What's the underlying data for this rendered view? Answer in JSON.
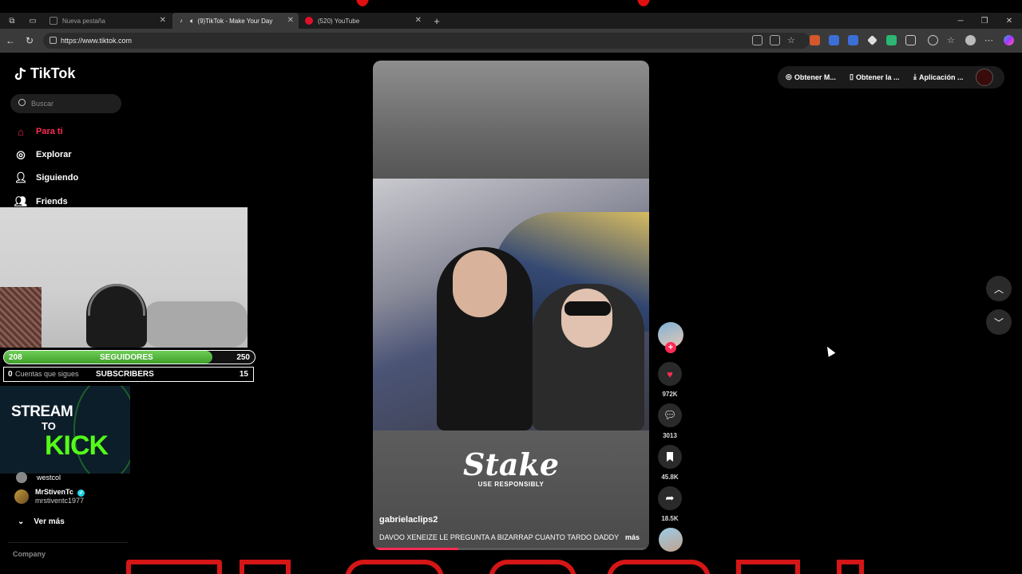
{
  "browser": {
    "tabs": [
      {
        "title": "Nueva pestaña",
        "active": false
      },
      {
        "title": "(9)TikTok - Make Your Day",
        "active": true
      },
      {
        "title": "(520) YouTube",
        "active": false
      }
    ],
    "url": "https://www.tiktok.com"
  },
  "sidebar": {
    "logo": "TikTok",
    "search_placeholder": "Buscar",
    "nav": [
      {
        "label": "Para ti"
      },
      {
        "label": "Explorar"
      },
      {
        "label": "Siguiendo"
      },
      {
        "label": "Friends"
      }
    ],
    "accounts": [
      {
        "name": "westcol",
        "handle": ""
      },
      {
        "name": "MrStivenTc",
        "handle": "mrstiventc1977"
      }
    ],
    "see_more": "Ver más",
    "footer_heading": "Company"
  },
  "overlay": {
    "followers": {
      "current": "208",
      "label": "SEGUIDORES",
      "goal": "250",
      "progress": 0.832
    },
    "subs": {
      "following_count": "0",
      "following_label": "Cuentas que sigues",
      "label": "SUBSCRIBERS",
      "count": "15"
    },
    "kick": {
      "line1": "STREAM",
      "line2": "TO",
      "line3": "KICK"
    }
  },
  "video": {
    "sponsor": "Stake",
    "sponsor_tagline": "USE RESPONSIBLY",
    "author": "gabrielaclips2",
    "caption": "DAVOO XENEIZE LE PREGUNTA A BIZARRAP CUANTO TARDO DADDY",
    "more": "más",
    "progress": 0.31
  },
  "actions": {
    "likes": "972K",
    "comments": "3013",
    "saves": "45.8K",
    "shares": "18.5K"
  },
  "topbar": {
    "coins": "Obtener M...",
    "app": "Obtener la ...",
    "download": "Aplicación ..."
  },
  "colors": {
    "accent": "#fe2c55",
    "kick_green": "#53fc18",
    "bar_green": "#4caf3a"
  }
}
